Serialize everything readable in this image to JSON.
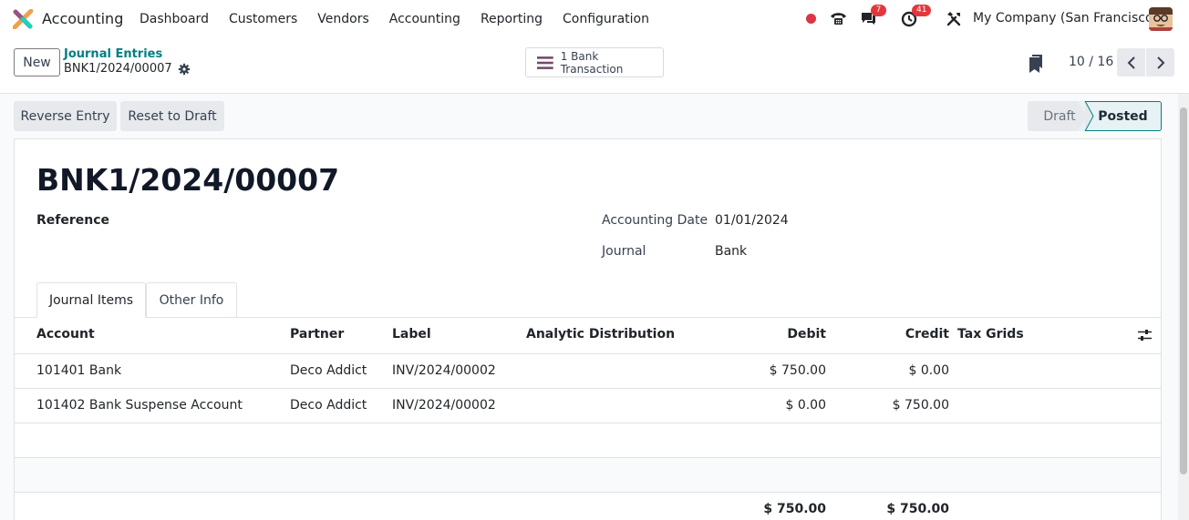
{
  "navbar": {
    "app_name": "Accounting",
    "menu": [
      "Dashboard",
      "Customers",
      "Vendors",
      "Accounting",
      "Reporting",
      "Configuration"
    ],
    "messages_badge": "7",
    "activities_badge": "41",
    "company": "My Company (San Francisco)"
  },
  "control": {
    "new_label": "New",
    "breadcrumb_parent": "Journal Entries",
    "breadcrumb_current": "BNK1/2024/00007",
    "smart_button": "1 Bank Transaction",
    "pager": "10 / 16"
  },
  "statusbar": {
    "reverse_label": "Reverse Entry",
    "reset_label": "Reset to Draft",
    "states": [
      "Draft",
      "Posted"
    ],
    "current_state": "Posted"
  },
  "form": {
    "title": "BNK1/2024/00007",
    "reference_label": "Reference",
    "accounting_date_label": "Accounting Date",
    "accounting_date": "01/01/2024",
    "journal_label": "Journal",
    "journal": "Bank"
  },
  "tabs": [
    "Journal Items",
    "Other Info"
  ],
  "table": {
    "headers": [
      "Account",
      "Partner",
      "Label",
      "Analytic Distribution",
      "Debit",
      "Credit",
      "Tax Grids"
    ],
    "rows": [
      {
        "account": "101401 Bank",
        "partner": "Deco Addict",
        "label": "INV/2024/00002",
        "debit": "$ 750.00",
        "credit": "$ 0.00"
      },
      {
        "account": "101402 Bank Suspense Account",
        "partner": "Deco Addict",
        "label": "INV/2024/00002",
        "debit": "$ 0.00",
        "credit": "$ 750.00"
      }
    ],
    "total_debit": "$ 750.00",
    "total_credit": "$ 750.00"
  },
  "colors": {
    "accent": "#017e84",
    "badge": "#e4373c"
  }
}
